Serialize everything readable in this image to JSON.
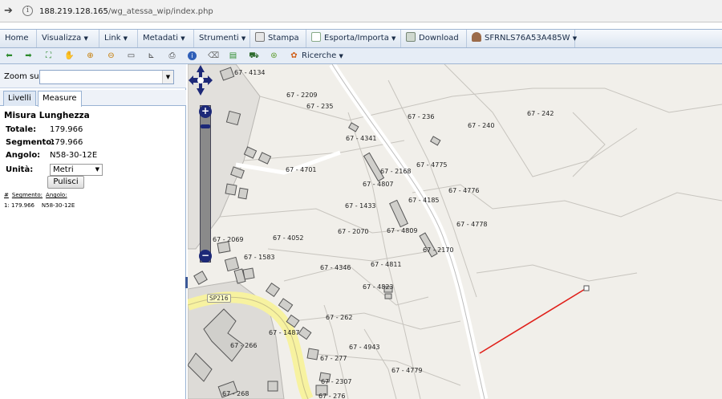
{
  "browser": {
    "nav_arrow": "➔",
    "info_glyph": "i",
    "url_host": "188.219.128.165",
    "url_path": "/wg_atessa_wip/index.php"
  },
  "menu": {
    "home": "Home",
    "visualizza": "Visualizza",
    "link": "Link",
    "metadati": "Metadati",
    "strumenti": "Strumenti",
    "stampa": "Stampa",
    "esporta": "Esporta/Importa",
    "download": "Download",
    "user": "SFRNLS76A53A485W",
    "caret": "▼"
  },
  "toolbar": {
    "ricerche": "Ricerche",
    "icons": [
      "back-arrow-icon",
      "forward-arrow-icon",
      "full-extent-icon",
      "pan-hand-icon",
      "zoom-in-icon",
      "zoom-out-icon",
      "measure-line-icon",
      "measure-area-icon",
      "print-icon",
      "info-icon",
      "eraser-icon",
      "document-icon",
      "car-icon",
      "globe-icon",
      "search-palette-icon"
    ]
  },
  "sidebar": {
    "zoom_label": "Zoom su:",
    "tab_livelli": "Livelli",
    "tab_measure": "Measure",
    "title": "Misura Lunghezza",
    "totale_label": "Totale:",
    "totale_value": "179.966",
    "segmento_label": "Segmento:",
    "segmento_value": "179.966",
    "angolo_label": "Angolo:",
    "angolo_value": "N58-30-12E",
    "unita_label": "Unità:",
    "unita_value": "Metri",
    "clear_button": "Pulisci",
    "col_num": "#",
    "col_segmento": "Segmento:",
    "col_angolo": "Angolo:",
    "row_index": "1:",
    "row_segmento": "179.966",
    "row_angolo": "N58-30-12E"
  },
  "map": {
    "road_label": "SP216",
    "measure_line_color": "#e0201a",
    "parcels": [
      "67 - 4134",
      "67 - 2209",
      "67 - 235",
      "67 - 236",
      "67 - 240",
      "67 - 242",
      "67 - 4341",
      "67 - 4701",
      "67 - 2168",
      "67 - 4775",
      "67 - 4807",
      "67 - 4776",
      "67 - 4185",
      "67 - 1433",
      "67 - 4778",
      "67 - 2069",
      "67 - 4052",
      "67 - 2070",
      "67 - 4809",
      "67 - 1583",
      "67 - 2170",
      "67 - 4346",
      "67 - 4811",
      "67 - 4823",
      "67 - 262",
      "67 - 1487",
      "67 - 266",
      "67 - 4943",
      "67 - 277",
      "67 - 4779",
      "67 - 2307",
      "67 - 268",
      "67 - 276"
    ],
    "zoom_in": "+",
    "zoom_out": "−"
  }
}
